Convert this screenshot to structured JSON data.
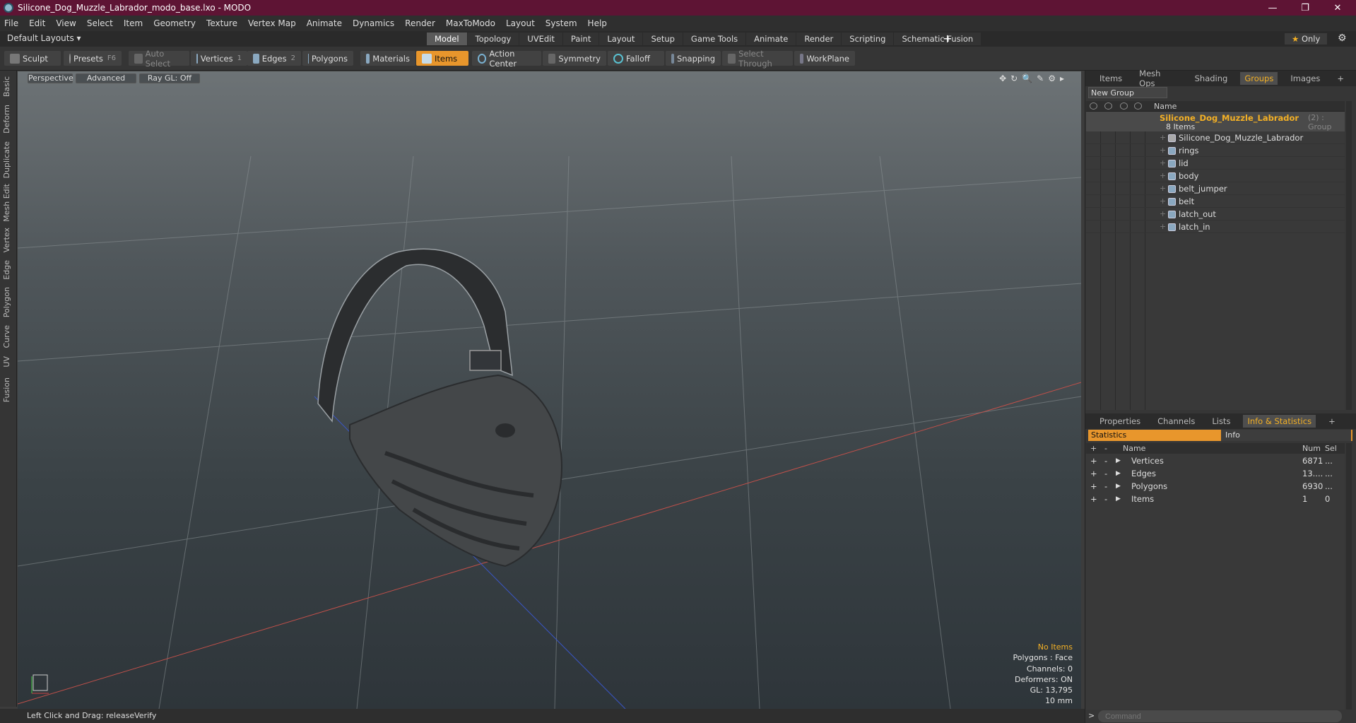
{
  "window": {
    "title": "Silicone_Dog_Muzzle_Labrador_modo_base.lxo - MODO",
    "minimize": "—",
    "maximize": "❐",
    "close": "✕"
  },
  "menu": [
    "File",
    "Edit",
    "View",
    "Select",
    "Item",
    "Geometry",
    "Texture",
    "Vertex Map",
    "Animate",
    "Dynamics",
    "Render",
    "MaxToModo",
    "Layout",
    "System",
    "Help"
  ],
  "layout": {
    "selector": "Default Layouts ▾",
    "tabs": [
      "Model",
      "Topology",
      "UVEdit",
      "Paint",
      "Layout",
      "Setup",
      "Game Tools",
      "Animate",
      "Render",
      "Scripting",
      "Schematic Fusion"
    ],
    "active_tab": "Model",
    "plus": "+",
    "only": "Only",
    "only_star": "★",
    "gear": "⚙"
  },
  "toolbar": {
    "sculpt": "Sculpt",
    "presets": "Presets",
    "presets_key": "F6",
    "auto_select": "Auto Select",
    "vertices": "Vertices",
    "vertices_num": "1",
    "edges": "Edges",
    "edges_num": "2",
    "polygons": "Polygons",
    "materials": "Materials",
    "items": "Items",
    "action_center": "Action Center",
    "symmetry": "Symmetry",
    "falloff": "Falloff",
    "snapping": "Snapping",
    "select_through": "Select Through",
    "workplane": "WorkPlane"
  },
  "left_tabs": [
    "Basic",
    "Deform",
    "Duplicate",
    "Mesh Edit",
    "Vertex",
    "Edge",
    "Polygon",
    "Curve",
    "UV",
    "Fusion"
  ],
  "viewport": {
    "perspective": "Perspective",
    "advanced": "Advanced",
    "raygl": "Ray GL: Off",
    "icons": "✥↻🔍✎⚙▸"
  },
  "hud": {
    "no_items": "No Items",
    "polygons": "Polygons : Face",
    "channels": "Channels: 0",
    "deformers": "Deformers: ON",
    "gl": "GL: 13,795",
    "scale": "10 mm"
  },
  "status": {
    "text": "Left Click and Drag:  releaseVerify"
  },
  "panel_top": {
    "tabs": [
      "Items",
      "Mesh Ops",
      "Shading",
      "Groups",
      "Images"
    ],
    "active": "Groups",
    "plus": "+",
    "new_group": "New Group",
    "name_header": "Name",
    "group": {
      "name": "Silicone_Dog_Muzzle_Labrador",
      "suffix": "(2) : Group",
      "count": "8 Items"
    },
    "items": [
      "Silicone_Dog_Muzzle_Labrador",
      "rings",
      "lid",
      "body",
      "belt_jumper",
      "belt",
      "latch_out",
      "latch_in"
    ]
  },
  "panel_bottom": {
    "tabs": [
      "Properties",
      "Channels",
      "Lists",
      "Info & Statistics"
    ],
    "active": "Info & Statistics",
    "plus": "+",
    "stats_tab": "Statistics",
    "info_tab": "Info",
    "headers": {
      "name": "Name",
      "num": "Num",
      "sel": "Sel"
    },
    "rows": [
      {
        "name": "Vertices",
        "num": "6871",
        "sel": "..."
      },
      {
        "name": "Edges",
        "num": "13....",
        "sel": "..."
      },
      {
        "name": "Polygons",
        "num": "6930",
        "sel": "..."
      },
      {
        "name": "Items",
        "num": "1",
        "sel": "0"
      }
    ],
    "minus": "-",
    "expand": "▶"
  },
  "command": {
    "placeholder": "Command",
    "prompt": ">"
  },
  "colors": {
    "title_bg": "#5e1434",
    "accent": "#e8962c",
    "highlight": "#f3b025"
  }
}
